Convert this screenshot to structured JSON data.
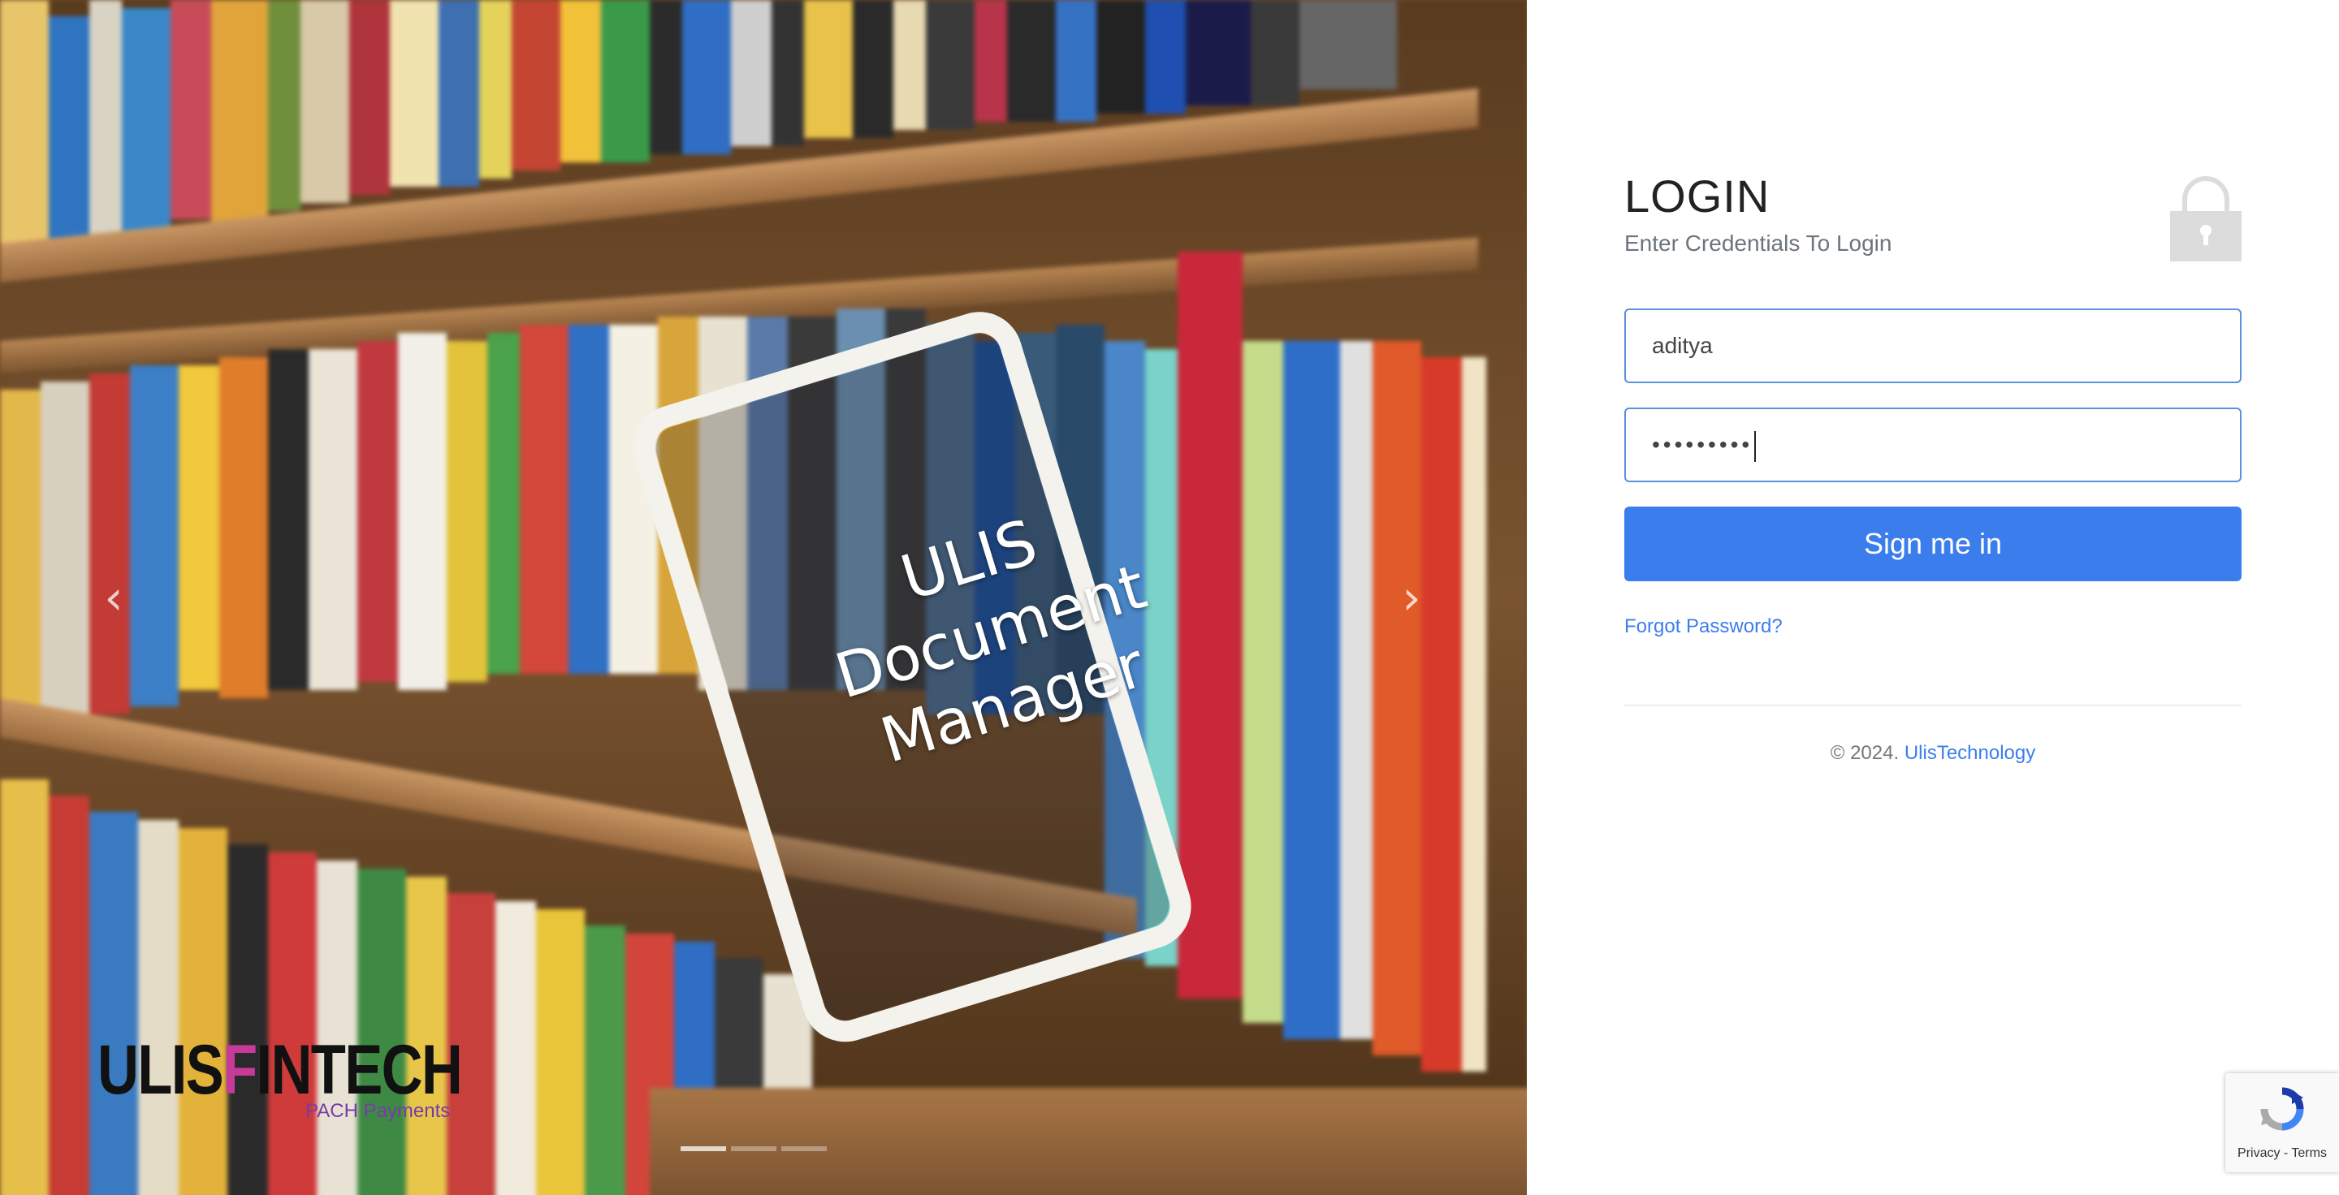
{
  "carousel": {
    "caption": [
      "ULIS",
      "Document",
      "Manager"
    ],
    "prev_arrow": "‹",
    "next_arrow": "›",
    "indicators": 3,
    "active_indicator": 0
  },
  "logo": {
    "main_left": "ULIS",
    "main_f": "F",
    "main_right": "INTECH",
    "tagline": "PACH Payments"
  },
  "login": {
    "title": "LOGIN",
    "subtitle": "Enter Credentials To Login",
    "username_value": "aditya",
    "password_mask": "•••••••••",
    "signin_label": "Sign me in",
    "forgot_label": "Forgot Password?",
    "footer_copyright": "© 2024.",
    "footer_brand": "UlisTechnology"
  },
  "recaptcha": {
    "privacy_label": "Privacy",
    "separator": "-",
    "terms_label": "Terms"
  },
  "colors": {
    "primary": "#3b7ded",
    "input_border": "#5b8fdf",
    "muted_text": "#6c757d"
  }
}
